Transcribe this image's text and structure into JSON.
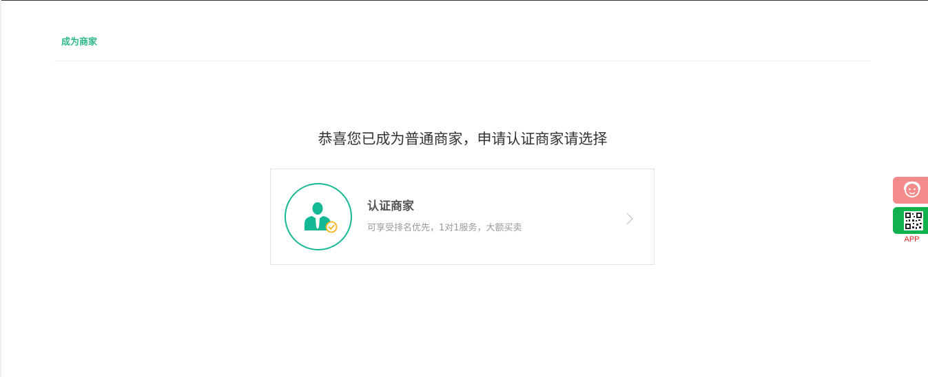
{
  "breadcrumb": {
    "label": "成为商家"
  },
  "headline": "恭喜您已成为普通商家，申请认证商家请选择",
  "option": {
    "title": "认证商家",
    "description": "可享受排名优先，1对1服务，大额买卖",
    "icon": "certified-merchant-icon"
  },
  "side_tools": {
    "service_icon": "customer-service-icon",
    "app_icon": "qr-code-icon",
    "app_label": "APP"
  },
  "colors": {
    "accent_green": "#2eb88b",
    "circle_teal": "#14b894",
    "badge_yellow": "#f5b31b",
    "service_pink": "#f38b8b",
    "app_green": "#0fb24c",
    "app_label_red": "#e02020"
  }
}
